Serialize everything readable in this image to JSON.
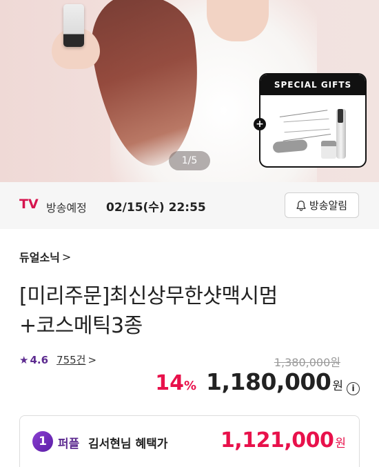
{
  "hero": {
    "pager": "1/5",
    "gifts_title": "SPECIAL GIFTS",
    "gifts_plus": "+"
  },
  "broadcast": {
    "channel": "TV",
    "status": "방송예정",
    "datetime": "02/15(수) 22:55",
    "alarm_label": "방송알림"
  },
  "product": {
    "brand": "듀얼소닉",
    "brand_chevron": ">",
    "title_line1": "[미리주문]최신상무한샷맥시멈",
    "title_line2": "+코스메틱3종",
    "rating": "4.6",
    "review_count": "755건",
    "review_chevron": ">",
    "original_price": "1,380,000원",
    "discount": "14",
    "discount_unit": "%",
    "price": "1,180,000",
    "price_unit": "원",
    "info_symbol": "i"
  },
  "benefit": {
    "tier_number": "1",
    "tier_name": "퍼플",
    "label": "김서현님 혜택가",
    "price": "1,121,000",
    "price_unit": "원"
  },
  "colors": {
    "accent_red": "#e8114b",
    "tv_red": "#d6154f",
    "purple": "#5d2b90"
  }
}
